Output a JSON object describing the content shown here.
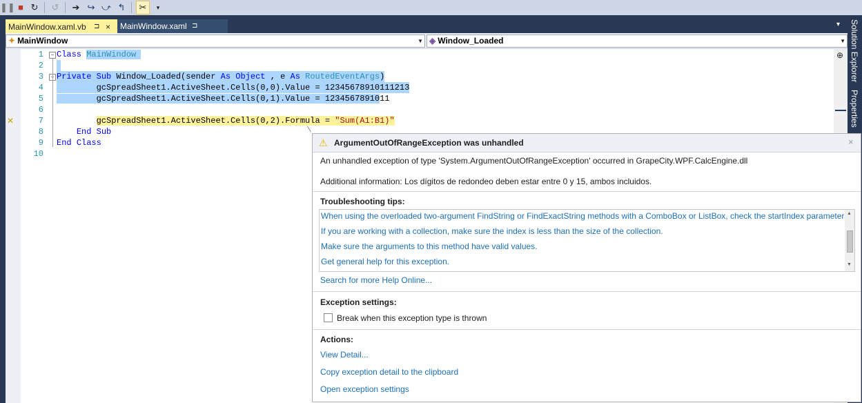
{
  "toolbar": {
    "buttons": [
      "pause-icon",
      "stop-icon",
      "restart-icon",
      "refresh-disabled-icon",
      "show-next-statement-icon",
      "step-into-icon",
      "step-over-icon",
      "step-out-icon",
      "toggle-icon",
      "dropdown-icon"
    ]
  },
  "tabs": [
    {
      "label": "MainWindow.xaml.vb",
      "pin": "⊐",
      "close": "×"
    },
    {
      "label": "MainWindow.xaml",
      "pin": "⊐"
    }
  ],
  "tab_overflow": "▾",
  "sidebar": {
    "items": [
      "Solution Explorer",
      "Properties"
    ]
  },
  "navbar": {
    "class_combo": "MainWindow",
    "member_combo": "Window_Loaded"
  },
  "editor": {
    "line_numbers": [
      "1",
      "2",
      "3",
      "4",
      "5",
      "6",
      "7",
      "8",
      "9",
      "10"
    ]
  },
  "exception": {
    "title": "ArgumentOutOfRangeException was unhandled",
    "description": "An unhandled exception of type 'System.ArgumentOutOfRangeException' occurred in GrapeCity.WPF.CalcEngine.dll",
    "additional": "Additional information: Los dígitos de redondeo deben estar entre 0 y 15, ambos incluidos.",
    "tips_header": "Troubleshooting tips:",
    "tips": [
      "When using the overloaded two-argument FindString or FindExactString methods with a ComboBox or ListBox, check the startIndex parameter.",
      "If you are working with a collection, make sure the index is less than the size of the collection.",
      "Make sure the arguments to this method have valid values.",
      "Get general help for this exception."
    ],
    "search_online": "Search for more Help Online...",
    "settings_header": "Exception settings:",
    "break_checkbox_label": "Break when this exception type is thrown",
    "actions_header": "Actions:",
    "actions": [
      "View Detail...",
      "Copy exception detail to the clipboard",
      "Open exception settings"
    ]
  }
}
